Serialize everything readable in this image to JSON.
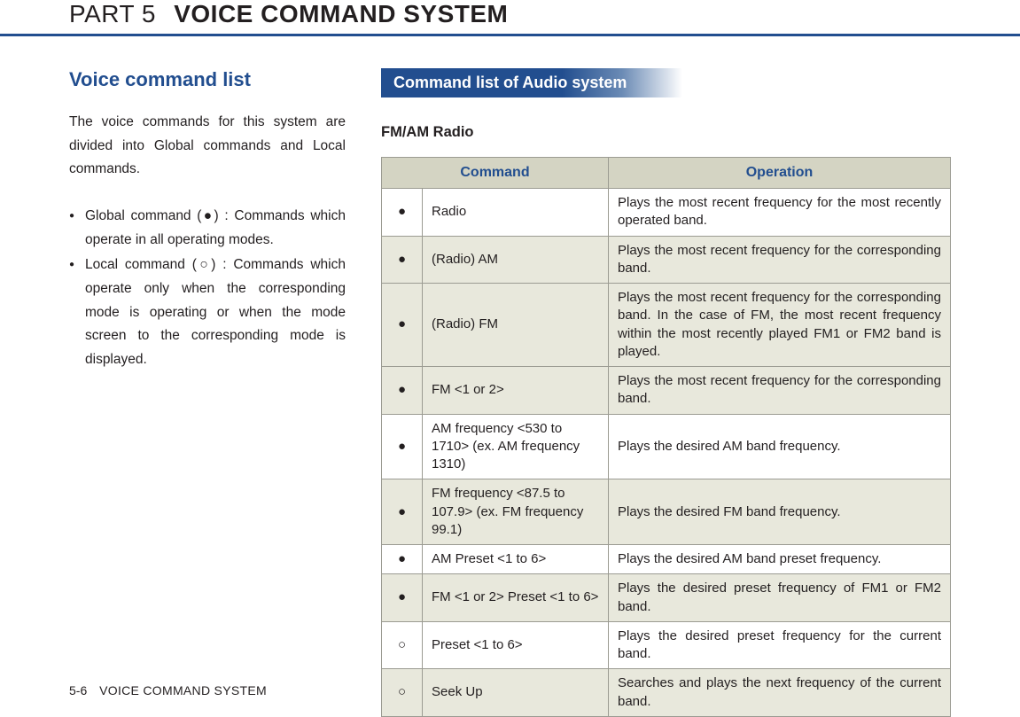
{
  "header": {
    "part_label": "PART 5",
    "part_name": "VOICE COMMAND SYSTEM"
  },
  "left": {
    "section_title": "Voice command list",
    "intro": "The voice commands for this system are divided into Global commands and Local commands.",
    "bullets": [
      "Global command (●) : Commands which operate in all operating modes.",
      "Local command (○) : Commands which operate only when the corresponding mode is operating or when the mode screen to the corresponding mode is displayed."
    ]
  },
  "right": {
    "banner": "Command list of Audio system",
    "table_title": "FM/AM Radio",
    "headers": {
      "command": "Command",
      "operation": "Operation"
    },
    "rows": [
      {
        "type": "●",
        "command": "Radio",
        "operation": "Plays the most recent frequency for the most recently operated band."
      },
      {
        "type": "●",
        "command": "(Radio) AM",
        "operation": "Plays the most recent frequency for the corresponding band."
      },
      {
        "type": "●",
        "command": " (Radio) FM",
        "operation": "Plays the most recent frequency for the corresponding band. In the case of FM, the most recent frequency within the most recently played FM1 or FM2 band is played."
      },
      {
        "type": "●",
        "command": "FM <1 or 2>",
        "operation": "Plays the most recent frequency for the corresponding band."
      },
      {
        "type": "●",
        "command": "AM frequency <530 to 1710> (ex. AM frequency 1310)",
        "operation": "Plays the desired AM band frequency."
      },
      {
        "type": "●",
        "command": "FM frequency <87.5 to 107.9> (ex. FM frequency 99.1)",
        "operation": "Plays the desired FM band frequency."
      },
      {
        "type": "●",
        "command": "AM Preset <1 to 6>",
        "operation": "Plays the desired AM band preset frequency."
      },
      {
        "type": "●",
        "command": "FM <1 or 2> Preset <1 to 6>",
        "operation": "Plays the desired preset frequency of FM1 or FM2 band."
      },
      {
        "type": "○",
        "command": "Preset <1 to 6>",
        "operation": "Plays the desired preset frequency for the current band."
      },
      {
        "type": "○",
        "command": "Seek Up",
        "operation": "Searches and plays the next frequency of the current band."
      }
    ]
  },
  "footer": {
    "page_number": "5-6",
    "page_name": "VOICE COMMAND SYSTEM"
  }
}
